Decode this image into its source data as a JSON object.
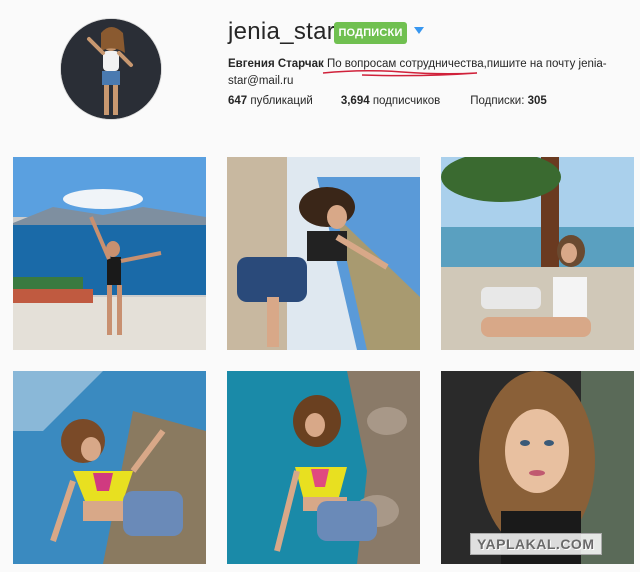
{
  "profile": {
    "username": "jenia_star",
    "follow_label": "ПОДПИСКИ",
    "full_name": "Евгения Старчак",
    "bio_text": "По вопросам сотрудничества,пишите на почту jenia-star@mail.ru",
    "stats": {
      "posts_count": "647",
      "posts_label": "публикаций",
      "followers_count": "3,694",
      "followers_label": "подписчиков",
      "following_label": "Подписки:",
      "following_count": "305"
    }
  },
  "posts": [
    {
      "id": "post-1"
    },
    {
      "id": "post-2"
    },
    {
      "id": "post-3"
    },
    {
      "id": "post-4"
    },
    {
      "id": "post-5"
    },
    {
      "id": "post-6"
    }
  ],
  "watermark": "YAPLAKAL.COM",
  "colors": {
    "follow_button": "#70c050",
    "dropdown_arrow": "#3897f0",
    "scribble": "#d0213a",
    "background": "#fafafa"
  }
}
